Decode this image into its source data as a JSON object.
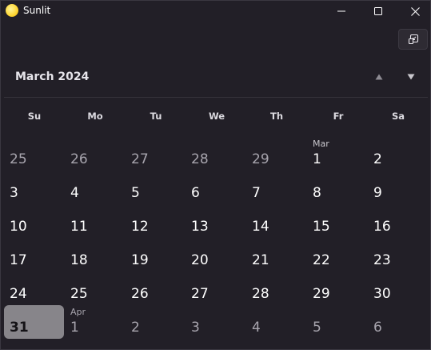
{
  "app": {
    "title": "Sunlit",
    "icon": "sun-app-icon"
  },
  "window_controls": {
    "minimize": "minimize-icon",
    "maximize": "maximize-icon",
    "close": "close-icon"
  },
  "toolbar": {
    "compact_overlay_icon": "compact-overlay-icon"
  },
  "calendar": {
    "month_label": "March 2024",
    "nav_up_icon": "triangle-up-icon",
    "nav_down_icon": "triangle-down-icon",
    "weekdays": [
      "Su",
      "Mo",
      "Tu",
      "We",
      "Th",
      "Fr",
      "Sa"
    ],
    "weeks": [
      [
        {
          "day": "25",
          "other": true
        },
        {
          "day": "26",
          "other": true
        },
        {
          "day": "27",
          "other": true
        },
        {
          "day": "28",
          "other": true
        },
        {
          "day": "29",
          "other": true
        },
        {
          "day": "1",
          "label": "Mar"
        },
        {
          "day": "2"
        }
      ],
      [
        {
          "day": "3"
        },
        {
          "day": "4"
        },
        {
          "day": "5"
        },
        {
          "day": "6"
        },
        {
          "day": "7"
        },
        {
          "day": "8"
        },
        {
          "day": "9"
        }
      ],
      [
        {
          "day": "10"
        },
        {
          "day": "11"
        },
        {
          "day": "12"
        },
        {
          "day": "13"
        },
        {
          "day": "14"
        },
        {
          "day": "15"
        },
        {
          "day": "16"
        }
      ],
      [
        {
          "day": "17"
        },
        {
          "day": "18"
        },
        {
          "day": "19"
        },
        {
          "day": "20"
        },
        {
          "day": "21"
        },
        {
          "day": "22"
        },
        {
          "day": "23"
        }
      ],
      [
        {
          "day": "24"
        },
        {
          "day": "25"
        },
        {
          "day": "26"
        },
        {
          "day": "27"
        },
        {
          "day": "28"
        },
        {
          "day": "29"
        },
        {
          "day": "30"
        }
      ],
      [
        {
          "day": "31",
          "today": true
        },
        {
          "day": "1",
          "label": "Apr",
          "other": true
        },
        {
          "day": "2",
          "other": true
        },
        {
          "day": "3",
          "other": true
        },
        {
          "day": "4",
          "other": true
        },
        {
          "day": "5",
          "other": true
        },
        {
          "day": "6",
          "other": true
        }
      ]
    ]
  },
  "colors": {
    "background": "#221f27",
    "today_highlight": "#87858a",
    "text_primary": "#ffffff",
    "text_other_month": "#a7a4ad"
  }
}
